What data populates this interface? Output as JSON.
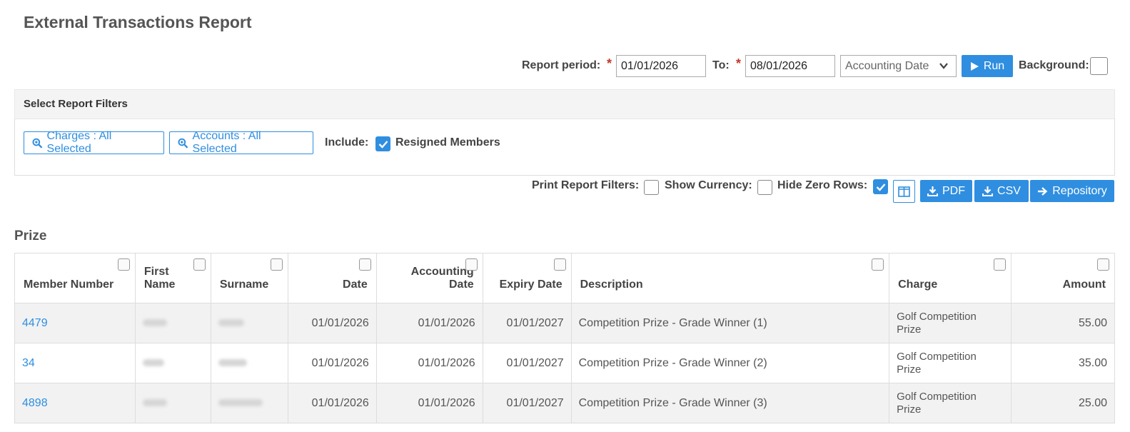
{
  "page": {
    "title": "External Transactions Report"
  },
  "period": {
    "label": "Report period:",
    "from_value": "01/01/2026",
    "to_label": "To:",
    "to_value": "08/01/2026",
    "date_type": "Accounting Date",
    "run_label": "Run",
    "background_label": "Background:",
    "background_checked": false
  },
  "filters": {
    "heading": "Select Report Filters",
    "charges_button": "Charges : All Selected",
    "accounts_button": "Accounts : All Selected",
    "include_label": "Include:",
    "resigned_label": "Resigned Members",
    "resigned_checked": true
  },
  "options": {
    "print_filters_label": "Print Report Filters:",
    "print_filters_checked": false,
    "show_currency_label": "Show Currency:",
    "show_currency_checked": false,
    "hide_zero_label": "Hide Zero Rows:",
    "hide_zero_checked": true,
    "pdf_label": "PDF",
    "csv_label": "CSV",
    "repository_label": "Repository"
  },
  "section": {
    "title": "Prize"
  },
  "table": {
    "columns": [
      "Member Number",
      "First Name",
      "Surname",
      "Date",
      "Accounting Date",
      "Expiry Date",
      "Description",
      "Charge",
      "Amount"
    ],
    "rows": [
      {
        "member": "4479",
        "date": "01/01/2026",
        "acc_date": "01/01/2026",
        "expiry": "01/01/2027",
        "description": "Competition Prize - Grade Winner (1)",
        "charge": "Golf Competition Prize",
        "amount": "55.00"
      },
      {
        "member": "34",
        "date": "01/01/2026",
        "acc_date": "01/01/2026",
        "expiry": "01/01/2027",
        "description": "Competition Prize - Grade Winner (2)",
        "charge": "Golf Competition Prize",
        "amount": "35.00"
      },
      {
        "member": "4898",
        "date": "01/01/2026",
        "acc_date": "01/01/2026",
        "expiry": "01/01/2027",
        "description": "Competition Prize - Grade Winner (3)",
        "charge": "Golf Competition Prize",
        "amount": "25.00"
      }
    ]
  },
  "colors": {
    "accent": "#2f8ee0",
    "required": "#c0392b",
    "row_alt": "#f2f2f2"
  }
}
